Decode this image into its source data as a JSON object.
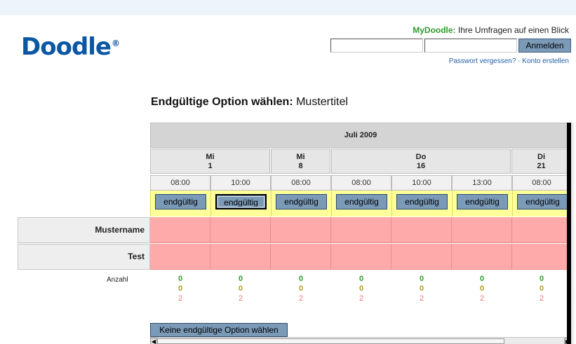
{
  "header": {
    "logo_text": "Doodle",
    "logo_mark": "®",
    "mydoodle_brand": "MyDoodle:",
    "mydoodle_tagline": " Ihre Umfragen auf einen Blick",
    "login_button": "Anmelden",
    "forgot_password": "Passwort vergessen?",
    "separator": " · ",
    "create_account": "Konto erstellen"
  },
  "page": {
    "title_bold": "Endgültige Option wählen:",
    "title_rest": " Mustertitel"
  },
  "poll": {
    "month": "Juli 2009",
    "days": [
      {
        "weekday": "Mi",
        "date": "1"
      },
      {
        "weekday": "Mi",
        "date": "8"
      },
      {
        "weekday": "Do",
        "date": "16"
      },
      {
        "weekday": "Di",
        "date": "21"
      }
    ],
    "times": [
      "08:00",
      "10:00",
      "08:00",
      "08:00",
      "10:00",
      "13:00",
      "08:00"
    ],
    "final_label": "endgültig",
    "participants": [
      "Mustername",
      "Test"
    ],
    "count_label": "Anzahl",
    "counts": [
      {
        "yes": "0",
        "maybe": "0",
        "no": "2"
      },
      {
        "yes": "0",
        "maybe": "0",
        "no": "2"
      },
      {
        "yes": "0",
        "maybe": "0",
        "no": "2"
      },
      {
        "yes": "0",
        "maybe": "0",
        "no": "2"
      },
      {
        "yes": "0",
        "maybe": "0",
        "no": "2"
      },
      {
        "yes": "0",
        "maybe": "0",
        "no": "2"
      },
      {
        "yes": "0",
        "maybe": "0",
        "no": "2"
      }
    ],
    "no_final_button": "Keine endgültige Option wählen"
  },
  "colors": {
    "brand_blue": "#0b57a4",
    "mydoodle_green": "#2e9b2e",
    "button_blue": "#7a9ab8",
    "final_row_yellow": "#ffff99",
    "no_vote_red": "#ffaaaa"
  },
  "icons": {
    "scroll_left": "arrow-left-icon",
    "scroll_right": "arrow-right-icon"
  }
}
